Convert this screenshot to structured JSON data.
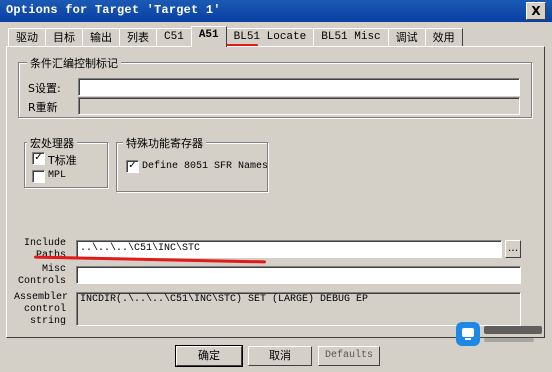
{
  "window": {
    "title": "Options for Target 'Target 1'",
    "close_glyph": "X"
  },
  "tabs": [
    {
      "label": "驱动",
      "active": false
    },
    {
      "label": "目标",
      "active": false
    },
    {
      "label": "输出",
      "active": false
    },
    {
      "label": "列表",
      "active": false
    },
    {
      "label": "C51",
      "active": false
    },
    {
      "label": "A51",
      "active": true
    },
    {
      "label": "BL51 Locate",
      "active": false
    },
    {
      "label": "BL51 Misc",
      "active": false
    },
    {
      "label": "调试",
      "active": false
    },
    {
      "label": "效用",
      "active": false
    }
  ],
  "conditional_group": {
    "title": "条件汇编控制标记",
    "set_label": "S设置:",
    "set_value": "",
    "reset_label": "R重新",
    "reset_value": ""
  },
  "macro_group": {
    "title": "宏处理器",
    "standard_label": "T标准",
    "standard_checked": true,
    "mpl_label": "MPL",
    "mpl_checked": false
  },
  "sfr_group": {
    "title": "特殊功能寄存器",
    "define_label": "Define 8051 SFR Names",
    "define_checked": true
  },
  "include_paths": {
    "label": "Include Paths",
    "value": "..\\..\\..\\C51\\INC\\STC",
    "browse_label": "..."
  },
  "misc_controls": {
    "label": "Misc Controls",
    "value": ""
  },
  "assembler_string": {
    "label": "Assembler control string",
    "value": "INCDIR(.\\..\\..\\C51\\INC\\STC) SET (LARGE) DEBUG EP"
  },
  "buttons": {
    "ok": "确定",
    "cancel": "取消",
    "defaults": "Defaults"
  },
  "annotation_color": "#e21a1a"
}
